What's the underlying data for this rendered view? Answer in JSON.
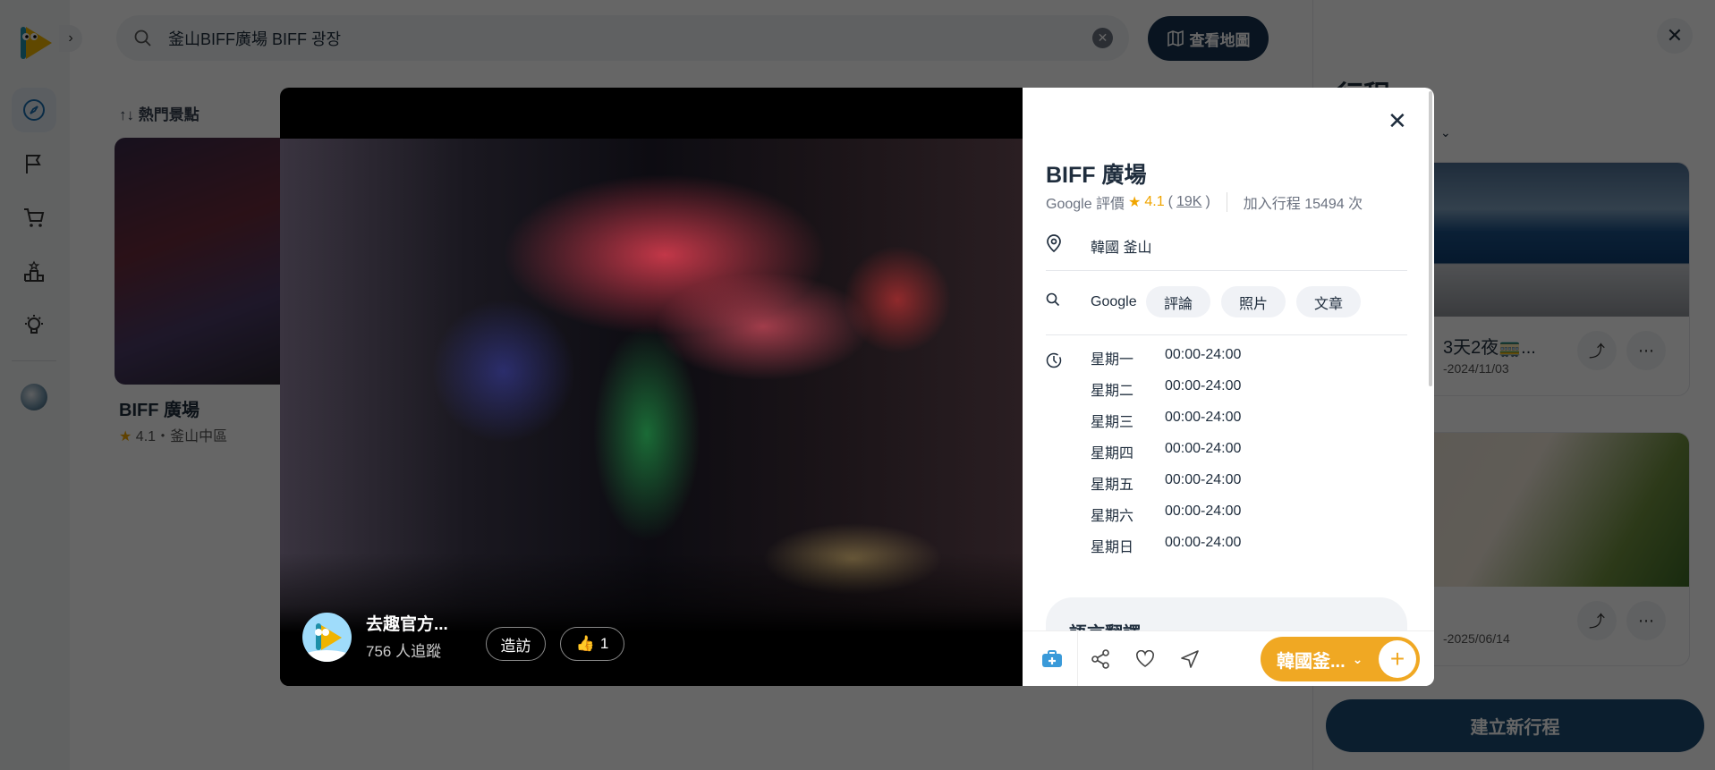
{
  "search": {
    "query": "釜山BIFF廣場 BIFF 광장",
    "map_button": "查看地圖"
  },
  "main": {
    "sort_label": "熱門景點",
    "card": {
      "title": "BIFF 廣場",
      "rating": "4.1",
      "separator": "・",
      "area": "釜山中區"
    }
  },
  "right_panel": {
    "title": "行程",
    "trips": [
      {
        "name": "3天2夜🚃...",
        "date": "-2024/11/03"
      },
      {
        "name": "",
        "date": "-2025/06/14"
      }
    ],
    "new_trip_button": "建立新行程"
  },
  "modal": {
    "author": {
      "name": "去趣官方...",
      "followers": "756 人追蹤",
      "visit_button": "造訪",
      "likes": "1"
    },
    "place": {
      "title": "BIFF 廣場",
      "google_label": "Google 評價",
      "rating": "4.1",
      "reviews_count": "19K",
      "added_label": "加入行程 15494 次",
      "location": "韓國 釜山"
    },
    "search": {
      "label": "Google",
      "chips": [
        "評論",
        "照片",
        "文章"
      ]
    },
    "hours": [
      {
        "day": "星期一",
        "time": "00:00-24:00"
      },
      {
        "day": "星期二",
        "time": "00:00-24:00"
      },
      {
        "day": "星期三",
        "time": "00:00-24:00"
      },
      {
        "day": "星期四",
        "time": "00:00-24:00"
      },
      {
        "day": "星期五",
        "time": "00:00-24:00"
      },
      {
        "day": "星期六",
        "time": "00:00-24:00"
      },
      {
        "day": "星期日",
        "time": "00:00-24:00"
      }
    ],
    "translate_title": "語言翻譯",
    "add_to_trip": "韓國釜..."
  },
  "colors": {
    "accent": "#f0a823",
    "brand": "#1b4a72",
    "star": "#f0a500"
  }
}
